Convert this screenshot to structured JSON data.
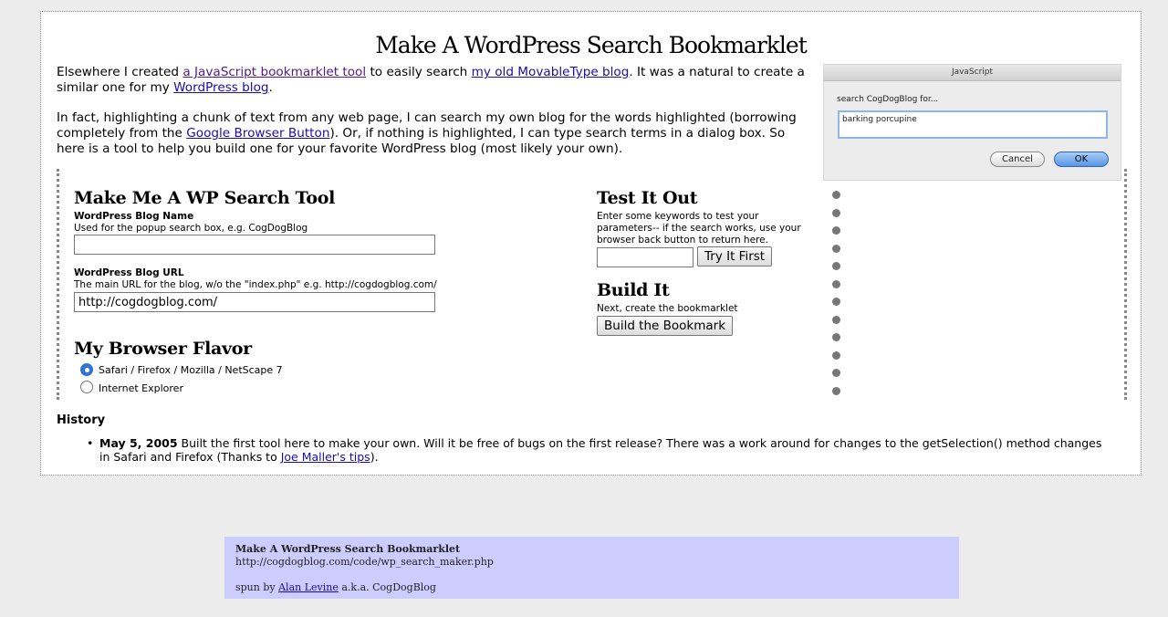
{
  "page": {
    "title": "Make A WordPress Search Bookmarklet"
  },
  "intro": {
    "p1_a": "Elsewhere I created ",
    "p1_link1": "a JavaScript bookmarklet tool",
    "p1_b": " to easily search ",
    "p1_link2": "my old MovableType blog",
    "p1_c": ". It was a natural to create a similar one for my ",
    "p1_link3": "WordPress blog",
    "p1_d": ".",
    "p2_a": "In fact, highlighting a chunk of text from any web page, I can search my own blog for the words highlighted (borrowing completely from the ",
    "p2_link": "Google Browser Button",
    "p2_b": "). Or, if nothing is highlighted, I can type search terms in a dialog box. So here is a tool to help you build one for your favorite WordPress blog (most likely your own)."
  },
  "dialog": {
    "title": "JavaScript",
    "prompt": "search CogDogBlog for...",
    "input_value": "barking porcupine",
    "cancel_label": "Cancel",
    "ok_label": "OK"
  },
  "make_tool": {
    "heading": "Make Me A WP Search Tool",
    "name_label": "WordPress Blog Name",
    "name_hint": "Used for the popup search box, e.g. CogDogBlog",
    "name_value": "",
    "url_label": "WordPress Blog URL",
    "url_hint": "The main URL for the blog, w/o the \"index.php\" e.g. http://cogdogblog.com/",
    "url_value": "http://cogdogblog.com/"
  },
  "browser": {
    "heading": "My Browser Flavor",
    "options": [
      {
        "label": "Safari / Firefox / Mozilla / NetScape 7",
        "selected": true
      },
      {
        "label": "Internet Explorer",
        "selected": false
      }
    ]
  },
  "test": {
    "heading": "Test It Out",
    "hint": "Enter some keywords to test your parameters-- if the search works, use your browser back button to return here.",
    "input_value": "",
    "button_label": "Try It First"
  },
  "build": {
    "heading": "Build It",
    "hint": "Next, create the bookmarklet",
    "button_label": "Build the Bookmark"
  },
  "history": {
    "title": "History",
    "entries": [
      {
        "date": "May 5, 2005",
        "text_a": " Built the first tool here to make your own. Will it be free of bugs on the first release? There was a work around for changes to the getSelection() method changes in Safari and Firefox (Thanks to ",
        "link": "Joe Maller's tips",
        "text_b": ")."
      }
    ]
  },
  "footer": {
    "title": "Make A WordPress Search Bookmarklet",
    "url": "http://cogdogblog.com/code/wp_search_maker.php",
    "credit_a": "spun by ",
    "credit_link": "Alan Levine",
    "credit_b": " a.k.a. CogDogBlog"
  },
  "colors": {
    "page_background": "#ececec",
    "link": "#1a0dab",
    "footer_background": "#ccccff",
    "radio_selected": "#2f74d0"
  }
}
